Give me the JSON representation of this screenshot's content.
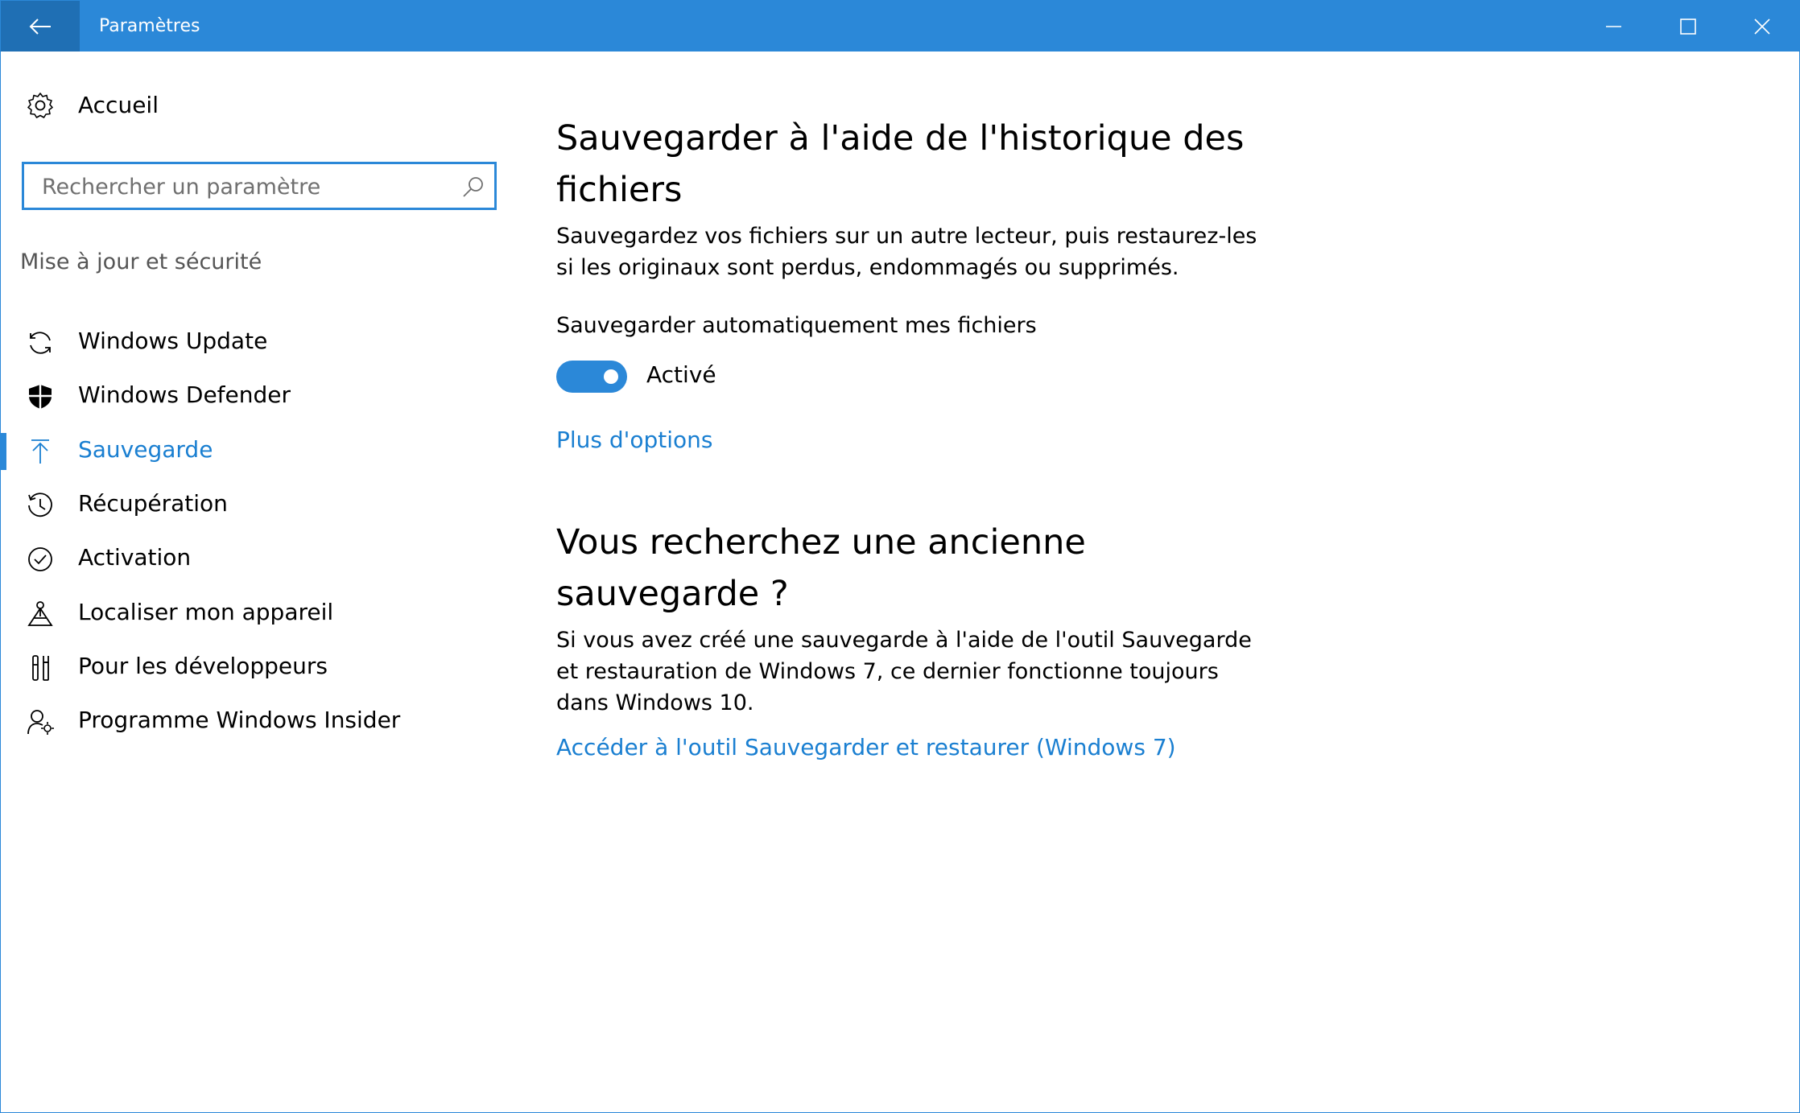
{
  "titlebar": {
    "title": "Paramètres",
    "accent": "#2b88d8",
    "back_accent": "#1f6fb4"
  },
  "sidebar": {
    "home_label": "Accueil",
    "search_placeholder": "Rechercher un paramètre",
    "section_header": "Mise à jour et sécurité",
    "items": [
      {
        "label": "Windows Update",
        "icon": "refresh-icon"
      },
      {
        "label": "Windows Defender",
        "icon": "shield-icon"
      },
      {
        "label": "Sauvegarde",
        "icon": "arrow-up-icon",
        "selected": true
      },
      {
        "label": "Récupération",
        "icon": "history-icon"
      },
      {
        "label": "Activation",
        "icon": "check-circle-icon"
      },
      {
        "label": "Localiser mon appareil",
        "icon": "location-person-icon"
      },
      {
        "label": "Pour les développeurs",
        "icon": "developer-tools-icon"
      },
      {
        "label": "Programme Windows Insider",
        "icon": "insider-icon"
      }
    ]
  },
  "main": {
    "title": "Sauvegarder à l'aide de l'historique des fichiers",
    "description": "Sauvegardez vos fichiers sur un autre lecteur, puis restaurez-les si les originaux sont perdus, endommagés ou supprimés.",
    "auto_backup_label": "Sauvegarder automatiquement mes fichiers",
    "toggle_state": "Activé",
    "toggle_on": true,
    "more_options_link": "Plus d'options",
    "old_backup_title": "Vous recherchez une ancienne sauvegarde ?",
    "old_backup_description": "Si vous avez créé une sauvegarde à l'aide de l'outil Sauvegarde et restauration de Windows 7, ce dernier fonctionne toujours dans Windows 10.",
    "win7_link": "Accéder à l'outil Sauvegarder et restaurer (Windows 7)"
  }
}
